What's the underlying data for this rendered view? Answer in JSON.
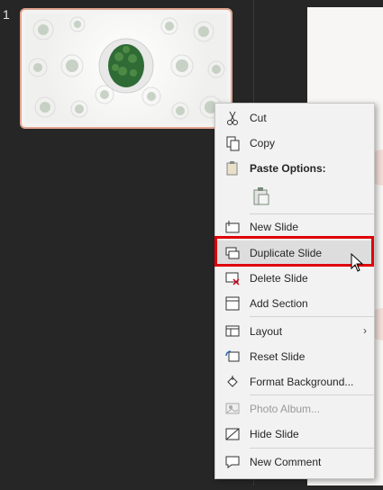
{
  "slide_panel": {
    "slide_number": "1"
  },
  "context_menu": {
    "cut": "Cut",
    "copy": "Copy",
    "paste_options": "Paste Options:",
    "new_slide": "New Slide",
    "duplicate_slide": "Duplicate Slide",
    "delete_slide": "Delete Slide",
    "add_section": "Add Section",
    "layout": "Layout",
    "reset_slide": "Reset Slide",
    "format_background": "Format Background...",
    "photo_album": "Photo Album...",
    "hide_slide": "Hide Slide",
    "new_comment": "New Comment"
  },
  "colors": {
    "highlight_border": "#e0000a",
    "thumbnail_border": "#e2a58f",
    "menu_background": "#f2f2f2"
  }
}
